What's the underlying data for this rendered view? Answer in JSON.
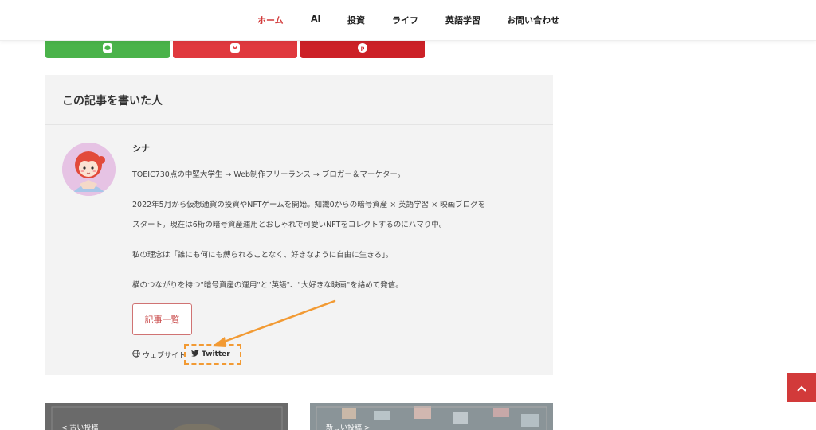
{
  "nav": {
    "items": [
      {
        "label": "ホーム",
        "active": true
      },
      {
        "label": "AI",
        "active": false
      },
      {
        "label": "投資",
        "active": false
      },
      {
        "label": "ライフ",
        "active": false
      },
      {
        "label": "英語学習",
        "active": false
      },
      {
        "label": "お問い合わせ",
        "active": false
      }
    ]
  },
  "share": {
    "buttons": [
      {
        "name": "line",
        "color": "#4ab34a",
        "icon": "line-icon"
      },
      {
        "name": "pocket",
        "color": "#e0393e",
        "icon": "pocket-icon"
      },
      {
        "name": "pinterest",
        "color": "#cc2127",
        "icon": "pinterest-icon"
      }
    ]
  },
  "author": {
    "box_title": "この記事を書いた人",
    "name": "シナ",
    "bio": [
      "TOEIC730点の中堅大学生 → Web制作フリーランス → ブロガー＆マーケター。",
      "2022年5月から仮想通貨の投資やNFTゲームを開始。知識0からの暗号資産 × 英語学習 × 映画ブログを",
      "スタート。現在は6桁の暗号資産運用とおしゃれで可愛いNFTをコレクトするのにハマり中。",
      "私の理念は「誰にも何にも縛られることなく、好きなように自由に生きる」。",
      "横のつながりを持つ\"暗号資産の運用\"と\"英語\"、\"大好きな映画\"を絡めて発信。"
    ],
    "articles_button": "記事一覧",
    "website_label": "ウェブサイト",
    "twitter_label": "Twitter"
  },
  "post_nav": {
    "prev_label": "< 古い投稿",
    "next_label": "新しい投稿 >"
  },
  "colors": {
    "accent": "#d23a3a",
    "annotation": "#f29a33"
  }
}
